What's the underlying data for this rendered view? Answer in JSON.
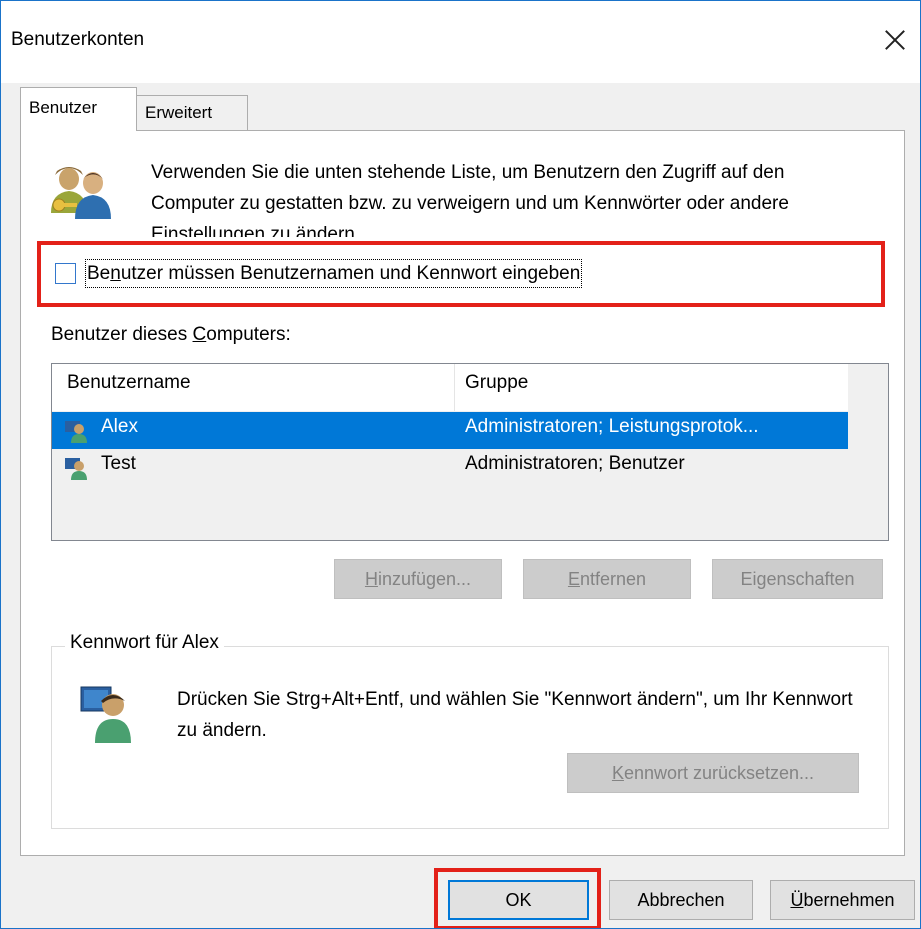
{
  "window": {
    "title": "Benutzerkonten"
  },
  "tabs": [
    {
      "label": "Benutzer",
      "active": true
    },
    {
      "label": "Erweitert",
      "active": false
    }
  ],
  "intro_text": "Verwenden Sie die unten stehende Liste, um Benutzern den Zugriff auf den Computer zu gestatten bzw. zu verweigern und um Kennwörter oder andere Einstellungen zu ändern.",
  "require_login": {
    "label_pre": "Be",
    "label_accel": "n",
    "label_post": "utzer müssen Benutzernamen und Kennwort eingeben",
    "checked": false
  },
  "users_label": {
    "pre": "Benutzer dieses ",
    "accel": "C",
    "post": "omputers:"
  },
  "user_list": {
    "columns": [
      "Benutzername",
      "Gruppe"
    ],
    "rows": [
      {
        "name": "Alex",
        "group": "Administratoren; Leistungsprotok...",
        "selected": true
      },
      {
        "name": "Test",
        "group": "Administratoren; Benutzer",
        "selected": false
      }
    ]
  },
  "user_buttons": {
    "add": {
      "accel": "H",
      "rest": "inzufügen..."
    },
    "remove": {
      "accel": "E",
      "rest": "ntfernen"
    },
    "props": {
      "pre": "Ei",
      "accel": "g",
      "rest": "enschaften"
    }
  },
  "password_group": {
    "title": "Kennwort für Alex",
    "text": "Drücken Sie Strg+Alt+Entf, und wählen Sie \"Kennwort ändern\", um Ihr Kennwort zu ändern.",
    "reset": {
      "accel": "K",
      "rest": "ennwort zurücksetzen..."
    }
  },
  "dialog_buttons": {
    "ok": "OK",
    "cancel": "Abbrechen",
    "apply": {
      "accel": "Ü",
      "rest": "bernehmen"
    }
  },
  "colors": {
    "selection": "#0078d7",
    "highlight_box": "#e32119",
    "window_border": "#1a73c9"
  }
}
